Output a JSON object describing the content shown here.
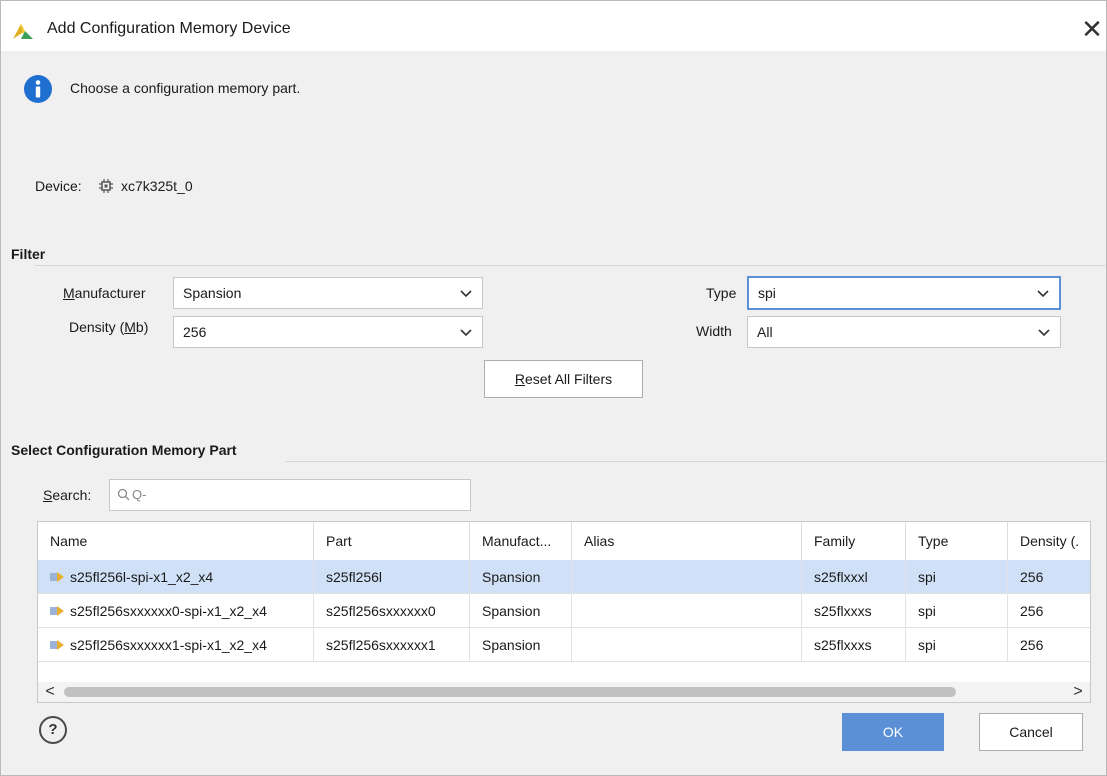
{
  "window": {
    "title": "Add Configuration Memory Device",
    "close_glyph": "✕"
  },
  "info": {
    "message": "Choose a configuration memory part."
  },
  "device": {
    "label": "Device:",
    "name": "xc7k325t_0"
  },
  "filter": {
    "section_title": "Filter",
    "manufacturer": {
      "label_pre": "",
      "label_mnemonic": "M",
      "label_post": "anufacturer",
      "value": "Spansion"
    },
    "density": {
      "label_pre": "Density (",
      "label_mnemonic": "M",
      "label_post": "b)",
      "value": "256"
    },
    "type": {
      "label": "Type",
      "value": "spi"
    },
    "width": {
      "label": "Width",
      "value": "All"
    },
    "reset_mnemonic": "R",
    "reset_rest": "eset All Filters"
  },
  "select": {
    "section_title": "Select Configuration Memory Part",
    "search_mnemonic": "S",
    "search_rest": "earch:",
    "search_placeholder": "Q-"
  },
  "table": {
    "columns": [
      "Name",
      "Part",
      "Manufact...",
      "Alias",
      "Family",
      "Type",
      "Density (."
    ],
    "rows": [
      {
        "name": "s25fl256l-spi-x1_x2_x4",
        "part": "s25fl256l",
        "manufacturer": "Spansion",
        "alias": "",
        "family": "s25flxxxl",
        "type": "spi",
        "density": "256"
      },
      {
        "name": "s25fl256sxxxxxx0-spi-x1_x2_x4",
        "part": "s25fl256sxxxxxx0",
        "manufacturer": "Spansion",
        "alias": "",
        "family": "s25flxxxs",
        "type": "spi",
        "density": "256"
      },
      {
        "name": "s25fl256sxxxxxx1-spi-x1_x2_x4",
        "part": "s25fl256sxxxxxx1",
        "manufacturer": "Spansion",
        "alias": "",
        "family": "s25flxxxs",
        "type": "spi",
        "density": "256"
      }
    ],
    "selected_row": 0,
    "scroll_left_glyph": "<",
    "scroll_right_glyph": ">"
  },
  "buttons": {
    "help": "?",
    "ok": "OK",
    "cancel": "Cancel"
  },
  "colors": {
    "accent": "#5b8fd6",
    "selection": "#cfe0f7",
    "info_blue": "#1f6fd0"
  }
}
